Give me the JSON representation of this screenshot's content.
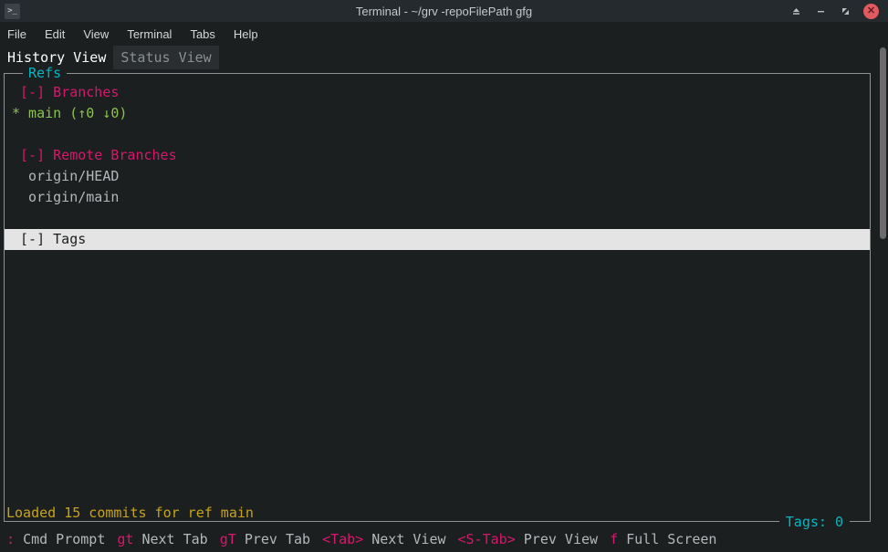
{
  "window": {
    "title": "Terminal - ~/grv -repoFilePath gfg",
    "app_icon": "terminal-prompt-icon",
    "controls": {
      "eject_label": "⏏",
      "minimize_label": "–",
      "maximize_label": "⤡",
      "close_label": "✕"
    }
  },
  "menubar": {
    "items": [
      {
        "label": "File"
      },
      {
        "label": "Edit"
      },
      {
        "label": "View"
      },
      {
        "label": "Terminal"
      },
      {
        "label": "Tabs"
      },
      {
        "label": "Help"
      }
    ]
  },
  "tabs": [
    {
      "label": "History View",
      "active": true
    },
    {
      "label": "Status View",
      "active": false
    }
  ],
  "refs_panel": {
    "title": "Refs",
    "footer": "Tags: 0",
    "rows": [
      {
        "text": " [-] Branches",
        "color": "magenta",
        "selected": false
      },
      {
        "text": "* main (↑0 ↓0)",
        "color": "green",
        "selected": false
      },
      {
        "text": "",
        "color": "grey",
        "selected": false
      },
      {
        "text": " [-] Remote Branches",
        "color": "magenta",
        "selected": false
      },
      {
        "text": "  origin/HEAD",
        "color": "grey",
        "selected": false
      },
      {
        "text": "  origin/main",
        "color": "grey",
        "selected": false
      },
      {
        "text": "",
        "color": "grey",
        "selected": false
      },
      {
        "text": " [-] Tags",
        "color": "white",
        "selected": true
      }
    ]
  },
  "status": {
    "message": "Loaded 15 commits for ref main"
  },
  "keybindings": [
    {
      "key": ":",
      "desc": "Cmd Prompt"
    },
    {
      "key": "gt",
      "desc": "Next Tab"
    },
    {
      "key": "gT",
      "desc": "Prev Tab"
    },
    {
      "key": "<Tab>",
      "desc": "Next View"
    },
    {
      "key": "<S-Tab>",
      "desc": "Prev View"
    },
    {
      "key": "f",
      "desc": "Full Screen"
    }
  ],
  "colors": {
    "accent_cyan": "#00b7c3",
    "magenta": "#d6186c",
    "green": "#8bc34a",
    "status_yellow": "#c8a317",
    "close_red": "#e05a5f"
  }
}
